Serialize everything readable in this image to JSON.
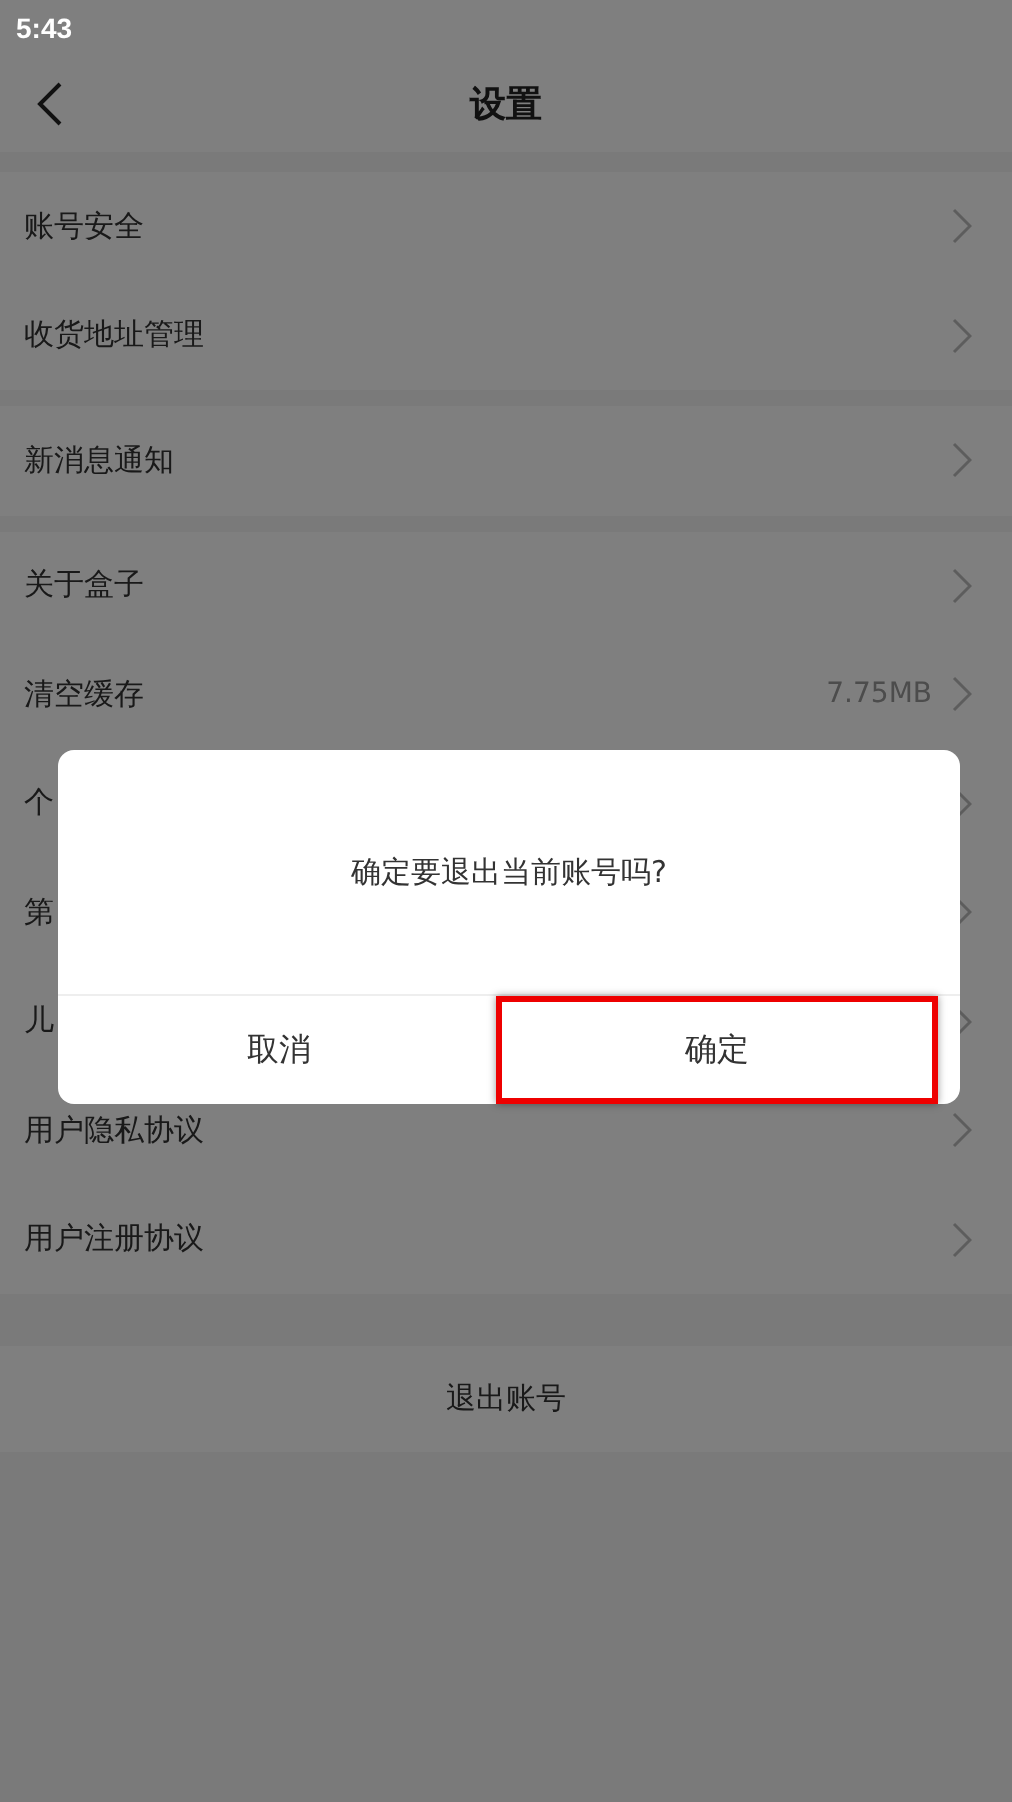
{
  "status_bar": {
    "time": "5:43"
  },
  "header": {
    "title": "设置"
  },
  "groups": [
    {
      "rows": [
        {
          "label": "账号安全"
        },
        {
          "label": "收货地址管理"
        }
      ]
    },
    {
      "rows": [
        {
          "label": "新消息通知"
        }
      ]
    },
    {
      "rows": [
        {
          "label": "关于盒子"
        },
        {
          "label": "清空缓存",
          "value": "7.75MB"
        },
        {
          "label": "个"
        },
        {
          "label": "第"
        },
        {
          "label": "儿"
        },
        {
          "label": "用户隐私协议"
        },
        {
          "label": "用户注册协议"
        }
      ]
    }
  ],
  "logout": {
    "label": "退出账号"
  },
  "dialog": {
    "message": "确定要退出当前账号吗?",
    "buttons": [
      {
        "label": "取消",
        "highlighted": false
      },
      {
        "label": "确定",
        "highlighted": true
      }
    ]
  }
}
